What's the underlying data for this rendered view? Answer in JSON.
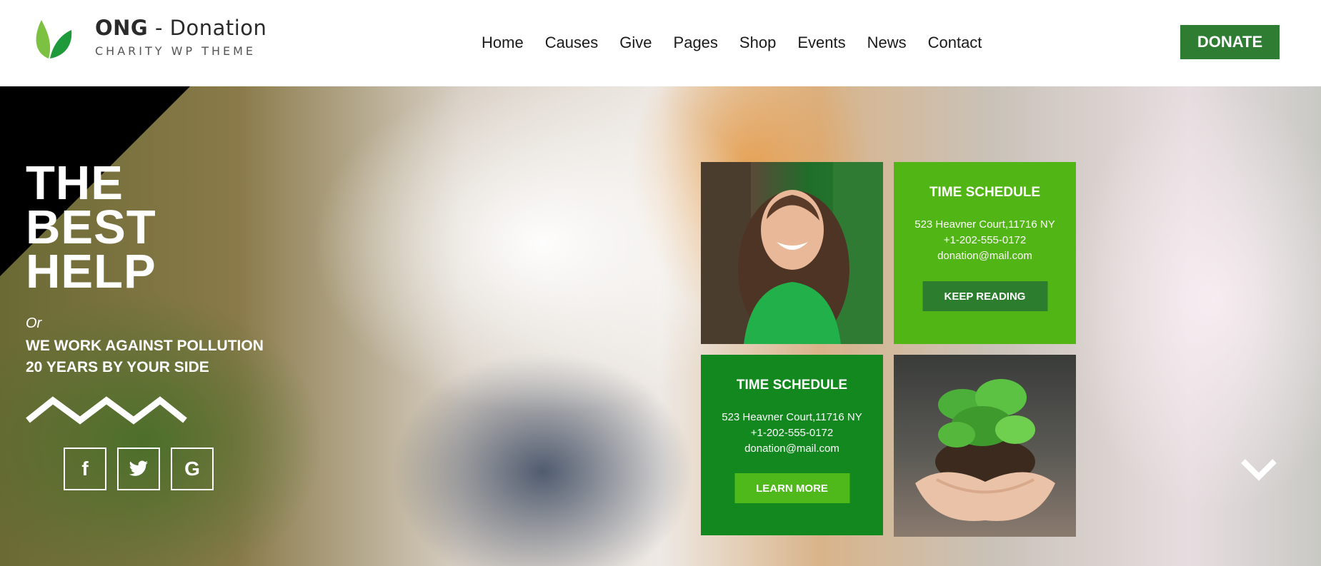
{
  "brand": {
    "title_bold": "ONG",
    "title_rest": " - Donation",
    "subtitle": "CHARITY WP THEME"
  },
  "nav": {
    "items": [
      "Home",
      "Causes",
      "Give",
      "Pages",
      "Shop",
      "Events",
      "News",
      "Contact"
    ]
  },
  "donate_label": "DONATE",
  "hero": {
    "title_lines": [
      "THE",
      "BEST",
      "HELP"
    ],
    "or_text": "Or",
    "line1": "WE WORK AGAINST POLLUTION",
    "line2": "20 YEARS BY YOUR SIDE"
  },
  "social": {
    "facebook": "f",
    "twitter": "t",
    "google": "G"
  },
  "cards": [
    {
      "title": "TIME SCHEDULE",
      "address": "523 Heavner Court,11716 NY",
      "phone": "+1-202-555-0172",
      "email": "donation@mail.com",
      "button": "KEEP READING"
    },
    {
      "title": "TIME SCHEDULE",
      "address": "523 Heavner Court,11716 NY",
      "phone": "+1-202-555-0172",
      "email": "donation@mail.com",
      "button": "LEARN MORE"
    }
  ],
  "colors": {
    "brand_green": "#2e7d32",
    "light_green": "#4caf1a",
    "dark_green": "#12881f"
  }
}
